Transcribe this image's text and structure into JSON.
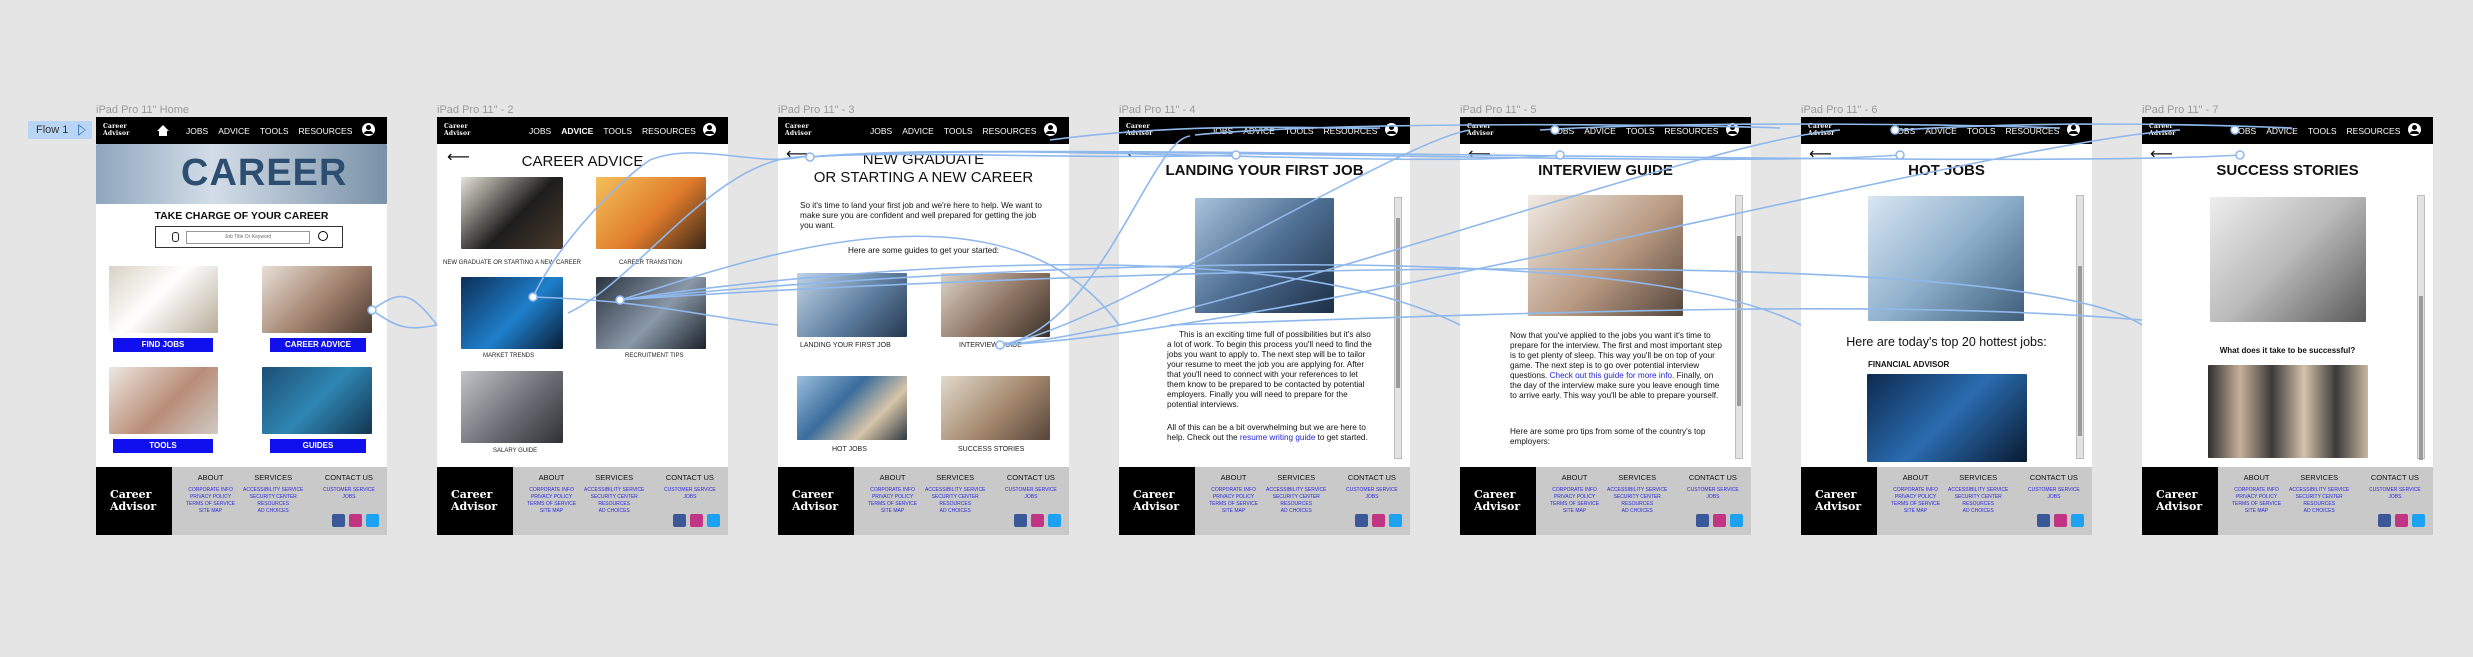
{
  "flow": {
    "label": "Flow 1"
  },
  "nav": {
    "logo_line1": "Career",
    "logo_line2": "Advisor",
    "links": [
      "JOBS",
      "ADVICE",
      "TOOLS",
      "RESOURCES"
    ]
  },
  "footer": {
    "logo_line1": "Career",
    "logo_line2": "Advisor",
    "about": {
      "heading": "ABOUT",
      "links": [
        "CORPORATE INFO",
        "PRIVACY POLICY",
        "TERMS OF SERVICE",
        "SITE MAP"
      ]
    },
    "services": {
      "heading": "SERVICES",
      "links": [
        "ACCESSIBILITY SERVICE",
        "SECURITY CENTER",
        "RESOURCES",
        "AD CHOICES"
      ]
    },
    "contact": {
      "heading": "CONTACT US",
      "links": [
        "CUSTOMER SERVICE",
        "JOBS"
      ]
    }
  },
  "frames": [
    {
      "label": "iPad Pro 11\" Home"
    },
    {
      "label": "iPad Pro 11\" - 2"
    },
    {
      "label": "iPad Pro 11\" - 3"
    },
    {
      "label": "iPad Pro 11\" - 4"
    },
    {
      "label": "iPad Pro 11\" - 5"
    },
    {
      "label": "iPad Pro 11\" - 6"
    },
    {
      "label": "iPad Pro 11\" - 7"
    }
  ],
  "home": {
    "hero_word": "CAREER",
    "heading": "TAKE CHARGE OF YOUR CAREER",
    "search_placeholder": "Job Title Or Keyword",
    "buttons": [
      "FIND JOBS",
      "CAREER ADVICE",
      "TOOLS",
      "GUIDES"
    ]
  },
  "advice": {
    "title": "CAREER ADVICE",
    "captions": [
      "NEW GRADUATE OR STARTING A NEW CAREER",
      "CAREER TRANSITION",
      "MARKET TRENDS",
      "RECRUITMENT TIPS",
      "SALARY GUIDE"
    ]
  },
  "newgrad": {
    "title_line1": "NEW GRADUATE",
    "title_line2": "OR STARTING A NEW CAREER",
    "intro": "So it's time to land your first job and we're here to help. We want to make sure you are confident and well prepared for getting the job you want.",
    "guides_line": "Here are some guides to get your started:",
    "captions": [
      "LANDING YOUR FIRST JOB",
      "INTERVIEW GUIDE",
      "HOT JOBS",
      "SUCCESS STORIES"
    ]
  },
  "landing": {
    "title": "LANDING YOUR FIRST JOB",
    "para1": "This is an exciting time full of possibilities but it's also a lot of work. To begin this process you'll need to find the jobs you want to apply to. The next step will be to tailor your resume to meet the job you are applying for. After that you'll need to connect with your references to let them know to be prepared to be contacted by potential employers. Finally you will need to prepare for the potential interviews.",
    "para2_pre": "All of this can be a bit overwhelming but we are here to help. Check out the ",
    "para2_link": "resume writing guide",
    "para2_post": " to get started."
  },
  "interview": {
    "title": "INTERVIEW GUIDE",
    "para1_pre": "Now that you've applied to the jobs you want it's time to prepare for the interview. The first and most important step is to get plenty of sleep. This way you'll be on top of your game. The next step is to go over potential interview questions. ",
    "para1_link": "Check out this guide for more info.",
    "para1_post": " Finally, on the day of the interview make sure you leave enough time to arrive early. This way you'll be able to prepare yourself.",
    "para2": "Here are some pro tips from some of the country's top employers:"
  },
  "hotjobs": {
    "title": "HOT JOBS",
    "subtitle": "Here are today's top 20 hottest jobs:",
    "first_job": "FINANCIAL ADVISOR"
  },
  "success": {
    "title": "SUCCESS STORIES",
    "question": "What does it take to be successful?"
  }
}
